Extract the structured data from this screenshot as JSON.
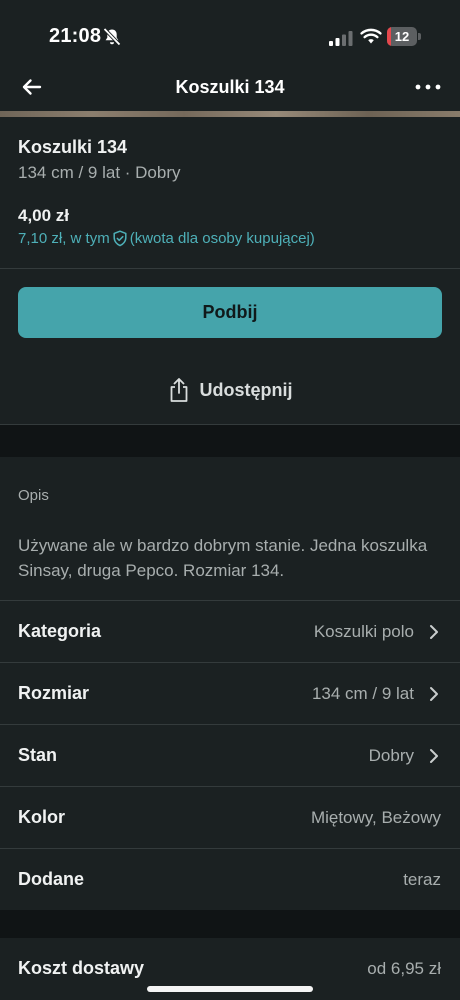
{
  "status_bar": {
    "time": "21:08",
    "battery_level": "12",
    "battery_fraction": 0.12,
    "battery_color": "#e5484d"
  },
  "nav": {
    "title": "Koszulki 134",
    "back_icon": "arrow-left-icon",
    "more_icon": "more-horizontal-icon"
  },
  "item": {
    "title": "Koszulki 134",
    "meta": "134 cm / 9 lat · Dobry",
    "price": "4,00 zł",
    "total_prefix": "7,10 zł, w tym",
    "total_suffix": "(kwota dla osoby kupującej)"
  },
  "actions": {
    "bump_label": "Podbij",
    "share_label": "Udostępnij"
  },
  "description": {
    "heading": "Opis",
    "text": "Używane ale w bardzo dobrym stanie. Jedna koszulka Sinsay, druga Pepco. Rozmiar 134."
  },
  "details": [
    {
      "label": "Kategoria",
      "value": "Koszulki polo"
    },
    {
      "label": "Rozmiar",
      "value": "134 cm / 9 lat"
    },
    {
      "label": "Stan",
      "value": "Dobry"
    },
    {
      "label": "Kolor",
      "value": "Miętowy, Beżowy"
    },
    {
      "label": "Dodane",
      "value": "teraz"
    }
  ],
  "shipping": {
    "label": "Koszt dostawy",
    "value": "od 6,95 zł"
  },
  "colors": {
    "accent": "#45a4ab",
    "link": "#4eb0b8",
    "background": "#1b2122"
  }
}
